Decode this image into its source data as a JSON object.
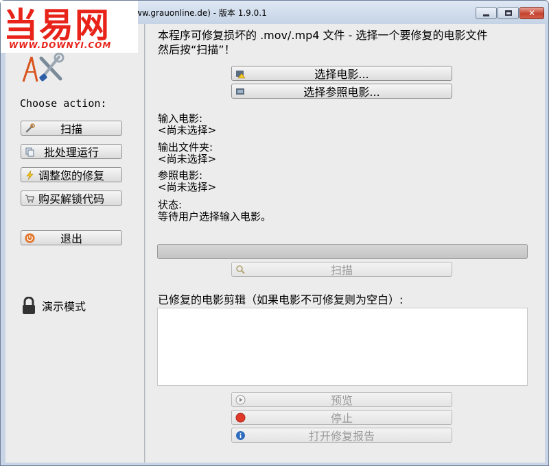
{
  "titlebar": {
    "title": "ww.grauonline.de) - 版本 1.9.0.1",
    "minimize_glyph": "",
    "maximize_glyph": "",
    "close_glyph": "✕"
  },
  "watermark": {
    "text": "当易网",
    "url": "WWW.DOWNYI.COM"
  },
  "left": {
    "choose_label": "Choose action:",
    "actions": [
      {
        "label": "扫描",
        "icon": "wrench-icon"
      },
      {
        "label": "批处理运行",
        "icon": "batch-icon"
      },
      {
        "label": "调整您的修复",
        "icon": "lightning-icon"
      },
      {
        "label": "购买解锁代码",
        "icon": "cart-icon"
      }
    ],
    "exit_label": "退出",
    "demo_mode_label": "演示模式"
  },
  "main": {
    "instruction": "本程序可修复损坏的 .mov/.mp4 文件 - 选择一个要修复的电影文件\n然后按“扫描”！",
    "select_movie_label": "选择电影...",
    "select_reference_label": "选择参照电影...",
    "input_movie_label": "输入电影:",
    "input_movie_value": "<尚未选择>",
    "output_folder_label": "输出文件夹:",
    "output_folder_value": "<尚未选择>",
    "reference_movie_label": "参照电影:",
    "reference_movie_value": "<尚未选择>",
    "status_label": "状态:",
    "status_value": "等待用户选择输入电影。",
    "progress_fraction": 0,
    "scan_label": "扫描",
    "repaired_clips_label": "已修复的电影剪辑（如果电影不可修复则为空白）:",
    "preview_label": "预览",
    "stop_label": "停止",
    "open_report_label": "打开修复报告"
  },
  "colors": {
    "accent_red": "#e8241a",
    "panel_bg": "#ececec",
    "stop_red": "#e03b2a",
    "info_blue": "#2f6dbf"
  }
}
